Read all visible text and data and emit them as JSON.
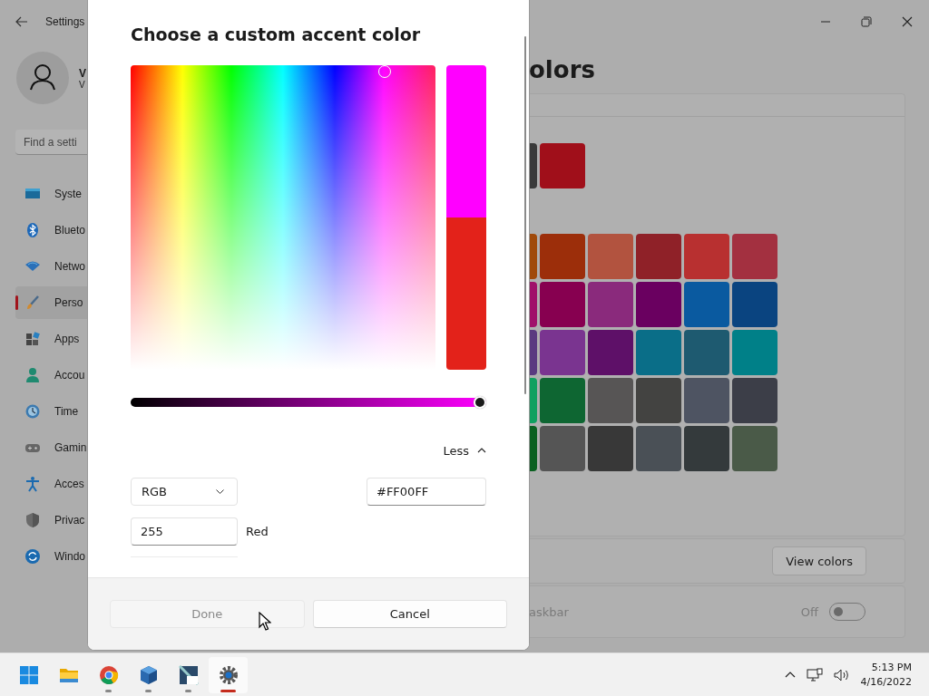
{
  "settings_window": {
    "title": "Settings",
    "user": {
      "name": "V",
      "email": "V"
    },
    "search": {
      "placeholder": "Find a setti"
    },
    "nav_items": [
      {
        "label": "Syste",
        "selected": false
      },
      {
        "label": "Blueto",
        "selected": false
      },
      {
        "label": "Netwo",
        "selected": false
      },
      {
        "label": "Perso",
        "selected": true
      },
      {
        "label": "Apps",
        "selected": false
      },
      {
        "label": "Accou",
        "selected": false
      },
      {
        "label": "Time",
        "selected": false
      },
      {
        "label": "Gamin",
        "selected": false
      },
      {
        "label": "Acces",
        "selected": false
      },
      {
        "label": "Privac",
        "selected": false
      },
      {
        "label": "Windo",
        "selected": false
      }
    ],
    "heading": "olors",
    "recent_colors": [
      {
        "color": "#3a3a3a"
      },
      {
        "color": "#a00f1a"
      }
    ],
    "windows_colors": [
      [
        {
          "color": "#a04a0a"
        },
        {
          "color": "#9c2e0a"
        },
        {
          "color": "#b2533f"
        },
        {
          "color": "#8f2128"
        },
        {
          "color": "#b83030"
        },
        {
          "color": "#a33040"
        }
      ],
      [
        {
          "color": "#a0106a"
        },
        {
          "color": "#870050"
        },
        {
          "color": "#8a2a7c"
        },
        {
          "color": "#6a0060"
        },
        {
          "color": "#0a5aa0"
        },
        {
          "color": "#0a4480"
        }
      ],
      [
        {
          "color": "#5a3a80"
        },
        {
          "color": "#7a3490"
        },
        {
          "color": "#5e1068"
        },
        {
          "color": "#0a6e88"
        },
        {
          "color": "#1e5a70"
        },
        {
          "color": "#008088"
        }
      ],
      [
        {
          "color": "#10a060"
        },
        {
          "color": "#0e6632"
        },
        {
          "color": "#575555"
        },
        {
          "color": "#434341"
        },
        {
          "color": "#4e5462"
        },
        {
          "color": "#3c3e48"
        }
      ],
      [
        {
          "color": "#0a6020"
        },
        {
          "color": "#555555"
        },
        {
          "color": "#383838"
        },
        {
          "color": "#4a5056"
        },
        {
          "color": "#343a3c"
        },
        {
          "color": "#4a5a48"
        }
      ]
    ],
    "view_colors_button": "View colors",
    "taskbar_row": {
      "label": "askbar",
      "disabled": true,
      "toggle_label": "Off",
      "on": false
    }
  },
  "dialog": {
    "title": "Choose a custom accent color",
    "preview": [
      {
        "color": "#ff00ff"
      },
      {
        "color": "#e3221a"
      }
    ],
    "value_slider": {
      "level": 1
    },
    "less_button": {
      "label": "Less",
      "expanded": true
    },
    "color_model": {
      "value": "RGB"
    },
    "hex_field": {
      "value": "#FF00FF"
    },
    "channels": [
      {
        "value": "255",
        "label": "Red"
      }
    ],
    "buttons": [
      {
        "label": "Done",
        "disabled": true
      },
      {
        "label": "Cancel",
        "disabled": false
      }
    ]
  },
  "taskbar": {
    "apps": [
      {
        "running": false,
        "active": false
      },
      {
        "running": false,
        "active": false
      },
      {
        "running": true,
        "active": false
      },
      {
        "running": true,
        "active": false
      },
      {
        "running": true,
        "active": false
      },
      {
        "running": true,
        "active": true
      }
    ],
    "clock": {
      "time": "5:13 PM",
      "date": "4/16/2022"
    }
  }
}
